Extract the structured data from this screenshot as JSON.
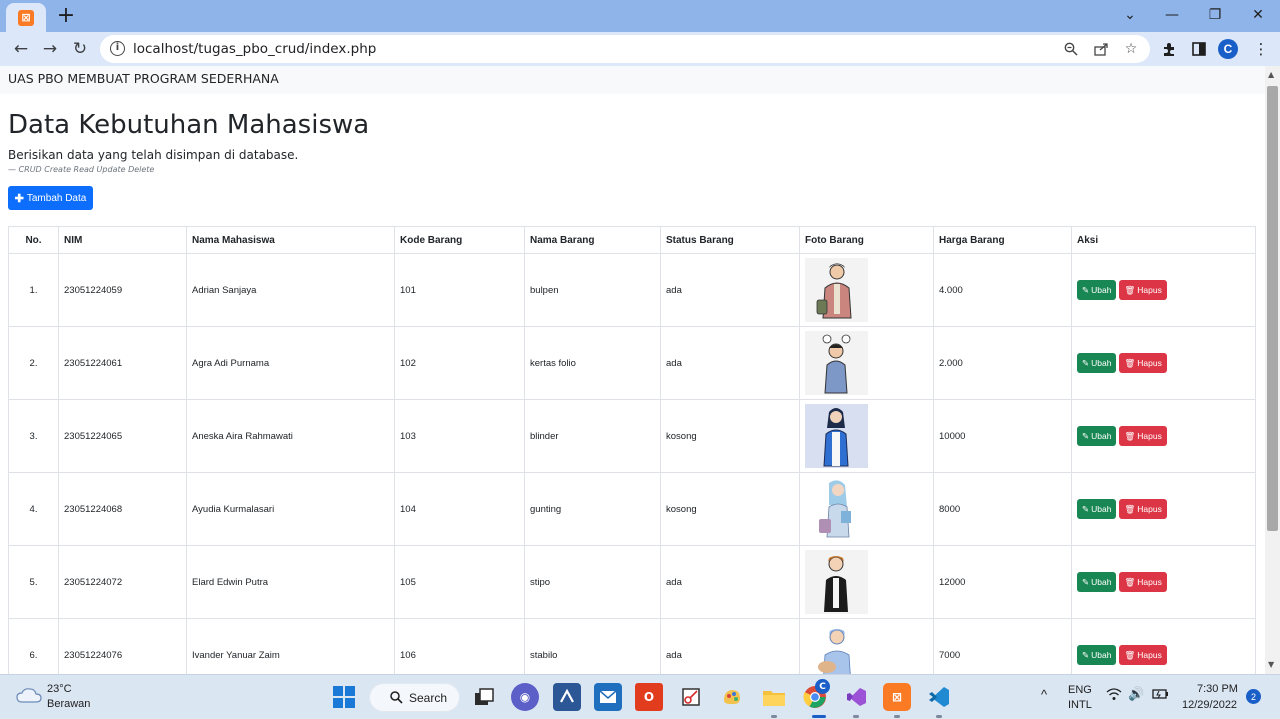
{
  "browser": {
    "tab_favicon": "xampp-icon",
    "new_tab": "+",
    "url": "localhost/tugas_pbo_crud/index.php",
    "profile_initial": "C"
  },
  "page": {
    "navbar_brand": "UAS PBO MEMBUAT PROGRAM SEDERHANA",
    "title": "Data Kebutuhan Mahasiswa",
    "lead": "Berisikan data yang telah disimpan di database.",
    "caption_prefix": "— ",
    "caption": "CRUD Create Read Update Delete",
    "add_button": "Tambah Data",
    "table": {
      "headers": [
        "No.",
        "NIM",
        "Nama Mahasiswa",
        "Kode Barang",
        "Nama Barang",
        "Status Barang",
        "Foto Barang",
        "Harga Barang",
        "Aksi"
      ],
      "rows": [
        {
          "no": "1.",
          "nim": "23051224059",
          "nama": "Adrian Sanjaya",
          "kode": "101",
          "barang": "bulpen",
          "status": "ada",
          "foto": "illustration-man-jacket",
          "harga": "4.000"
        },
        {
          "no": "2.",
          "nim": "23051224061",
          "nama": "Agra Adi Purnama",
          "kode": "102",
          "barang": "kertas folio",
          "status": "ada",
          "foto": "illustration-man-lightbulbs",
          "harga": "2.000"
        },
        {
          "no": "3.",
          "nim": "23051224065",
          "nama": "Aneska Aira Rahmawati",
          "kode": "103",
          "barang": "blinder",
          "status": "kosong",
          "foto": "illustration-woman-blue-jacket",
          "harga": "10000"
        },
        {
          "no": "4.",
          "nim": "23051224068",
          "nama": "Ayudia Kurmalasari",
          "kode": "104",
          "barang": "gunting",
          "status": "kosong",
          "foto": "illustration-woman-books",
          "harga": "8000"
        },
        {
          "no": "5.",
          "nim": "23051224072",
          "nama": "Elard Edwin Putra",
          "kode": "105",
          "barang": "stipo",
          "status": "ada",
          "foto": "illustration-man-black-jacket",
          "harga": "12000"
        },
        {
          "no": "6.",
          "nim": "23051224076",
          "nama": "Ivander Yanuar Zaim",
          "kode": "106",
          "barang": "stabilo",
          "status": "ada",
          "foto": "illustration-man-guitar",
          "harga": "7000"
        }
      ],
      "edit_label": "Ubah",
      "delete_label": "Hapus"
    }
  },
  "taskbar": {
    "temperature": "23°C",
    "weather": "Berawan",
    "search_label": "Search",
    "lang_line1": "ENG",
    "lang_line2": "INTL",
    "time": "7:30 PM",
    "date": "12/29/2022",
    "notification_count": "2",
    "chrome_badge": "C"
  },
  "colors": {
    "primary": "#0d6efd",
    "success": "#198754",
    "danger": "#dc3545",
    "browser_frame": "#8fb4ea",
    "taskbar": "#dbe6f3"
  }
}
